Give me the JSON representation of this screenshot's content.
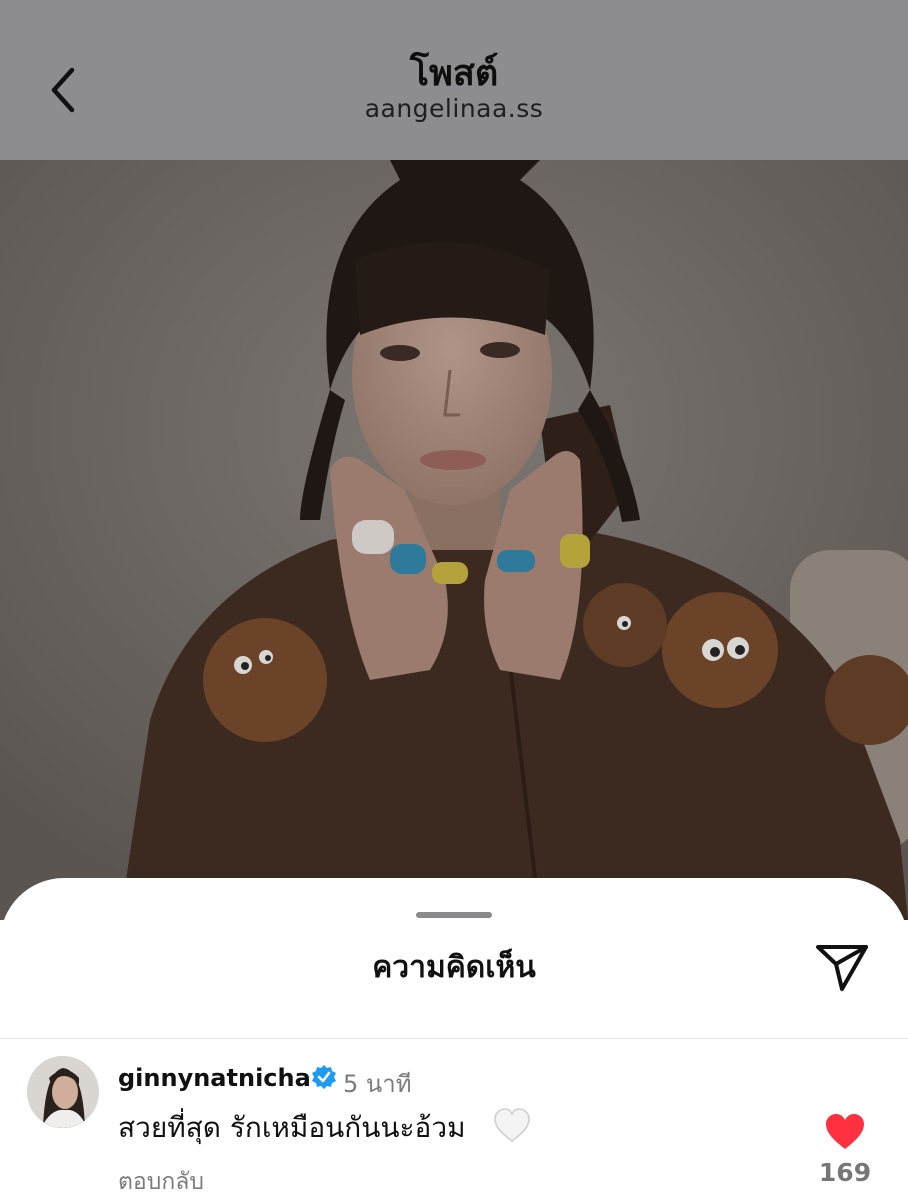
{
  "header": {
    "title": "โพสต์",
    "subtitle": "aangelinaa.ss"
  },
  "sheet": {
    "title": "ความคิดเห็น"
  },
  "comment": {
    "username": "ginnynatnicha",
    "time": "5 นาที",
    "text": "สวยที่สุด รักเหมือนกันนะอ้วม",
    "reply_label": "ตอบกลับ",
    "like_count": "169",
    "like_color": "#ff3040",
    "verified_color": "#1d9bf0"
  },
  "icons": {
    "back": "chevron-left-icon",
    "share": "paper-plane-icon",
    "like": "heart-icon",
    "verified": "verified-badge-icon",
    "emoji": "white-heart-emoji"
  }
}
